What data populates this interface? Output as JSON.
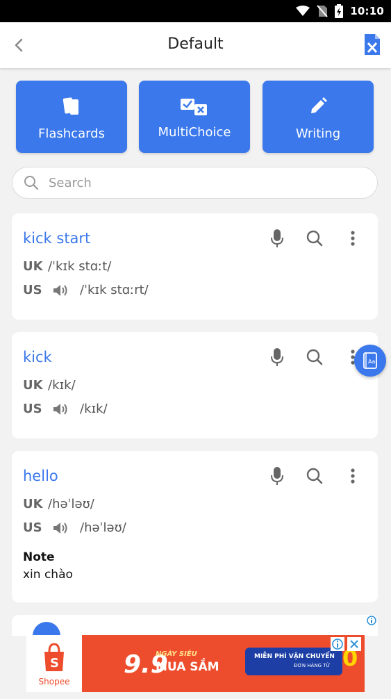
{
  "status_bar": {
    "time": "10:10"
  },
  "app_bar": {
    "title": "Default"
  },
  "modes": [
    {
      "label": "Flashcards"
    },
    {
      "label": "MultiChoice"
    },
    {
      "label": "Writing"
    }
  ],
  "search": {
    "placeholder": "Search",
    "value": ""
  },
  "cards": [
    {
      "word": "kick start",
      "uk_label": "UK",
      "uk_ipa": "/ˈkɪk stɑːt/",
      "us_label": "US",
      "us_ipa": "/ˈkɪk stɑːrt/"
    },
    {
      "word": "kick",
      "uk_label": "UK",
      "uk_ipa": "/kɪk/",
      "us_label": "US",
      "us_ipa": "/kɪk/"
    },
    {
      "word": "hello",
      "uk_label": "UK",
      "uk_ipa": "/həˈləʊ/",
      "us_label": "US",
      "us_ipa": "/həˈləʊ/",
      "note_label": "Note",
      "note_text": "xin chào"
    }
  ],
  "ad": {
    "brand": "Shopee",
    "big": "9.9",
    "small_top": "NGÀY SIÊU",
    "sale": "MUA SẮM",
    "free_ship": "MIỄN PHÍ VẬN CHUYỂN",
    "order_from": "ĐƠN HÀNG TỪ",
    "zero": "0"
  },
  "colors": {
    "accent": "#3a78ec",
    "background": "#f2f2f2",
    "status_bar": "#000000",
    "ad_brand": "#ee4d2d"
  }
}
